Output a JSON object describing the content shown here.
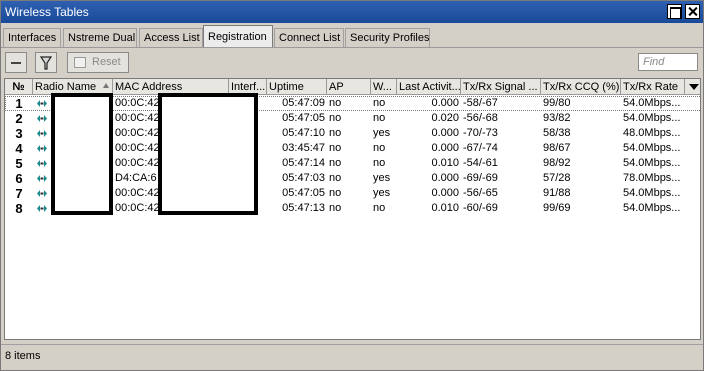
{
  "window": {
    "title": "Wireless Tables"
  },
  "tabs": [
    {
      "label": "Interfaces"
    },
    {
      "label": "Nstreme Dual"
    },
    {
      "label": "Access List"
    },
    {
      "label": "Registration"
    },
    {
      "label": "Connect List"
    },
    {
      "label": "Security Profiles"
    }
  ],
  "toolbar": {
    "reset_label": "Reset",
    "find_placeholder": "Find"
  },
  "columns": {
    "num": "№",
    "radio_name": "Radio Name",
    "mac": "MAC Address",
    "interface": "Interf...",
    "uptime": "Uptime",
    "ap": "AP",
    "w": "W...",
    "last_activity": "Last Activit...",
    "signal": "Tx/Rx Signal ...",
    "ccq": "Tx/Rx CCQ (%)",
    "rate": "Tx/Rx Rate"
  },
  "rows": [
    {
      "num": "1",
      "mac": "00:0C:42",
      "uptime": "05:47:09",
      "ap": "no",
      "w": "no",
      "last": "0.000",
      "signal": "-58/-67",
      "ccq": "99/80",
      "rate": "54.0Mbps..."
    },
    {
      "num": "2",
      "mac": "00:0C:42",
      "uptime": "05:47:05",
      "ap": "no",
      "w": "no",
      "last": "0.020",
      "signal": "-56/-68",
      "ccq": "93/82",
      "rate": "54.0Mbps..."
    },
    {
      "num": "3",
      "mac": "00:0C:42",
      "uptime": "05:47:10",
      "ap": "no",
      "w": "yes",
      "last": "0.000",
      "signal": "-70/-73",
      "ccq": "58/38",
      "rate": "48.0Mbps..."
    },
    {
      "num": "4",
      "mac": "00:0C:42",
      "uptime": "03:45:47",
      "ap": "no",
      "w": "no",
      "last": "0.000",
      "signal": "-67/-74",
      "ccq": "98/67",
      "rate": "54.0Mbps..."
    },
    {
      "num": "5",
      "mac": "00:0C:42",
      "uptime": "05:47:14",
      "ap": "no",
      "w": "no",
      "last": "0.010",
      "signal": "-54/-61",
      "ccq": "98/92",
      "rate": "54.0Mbps..."
    },
    {
      "num": "6",
      "mac": "D4:CA:6",
      "uptime": "05:47:03",
      "ap": "no",
      "w": "yes",
      "last": "0.000",
      "signal": "-69/-69",
      "ccq": "57/28",
      "rate": "78.0Mbps..."
    },
    {
      "num": "7",
      "mac": "00:0C:42",
      "uptime": "05:47:05",
      "ap": "no",
      "w": "yes",
      "last": "0.000",
      "signal": "-56/-65",
      "ccq": "91/88",
      "rate": "54.0Mbps..."
    },
    {
      "num": "8",
      "mac": "00:0C:42",
      "uptime": "05:47:13",
      "ap": "no",
      "w": "no",
      "last": "0.010",
      "signal": "-60/-69",
      "ccq": "99/69",
      "rate": "54.0Mbps..."
    }
  ],
  "status": {
    "text": "8 items"
  },
  "colors": {
    "title_bar": "#1a4a9a",
    "radio_icon": "#1a8a8a"
  }
}
